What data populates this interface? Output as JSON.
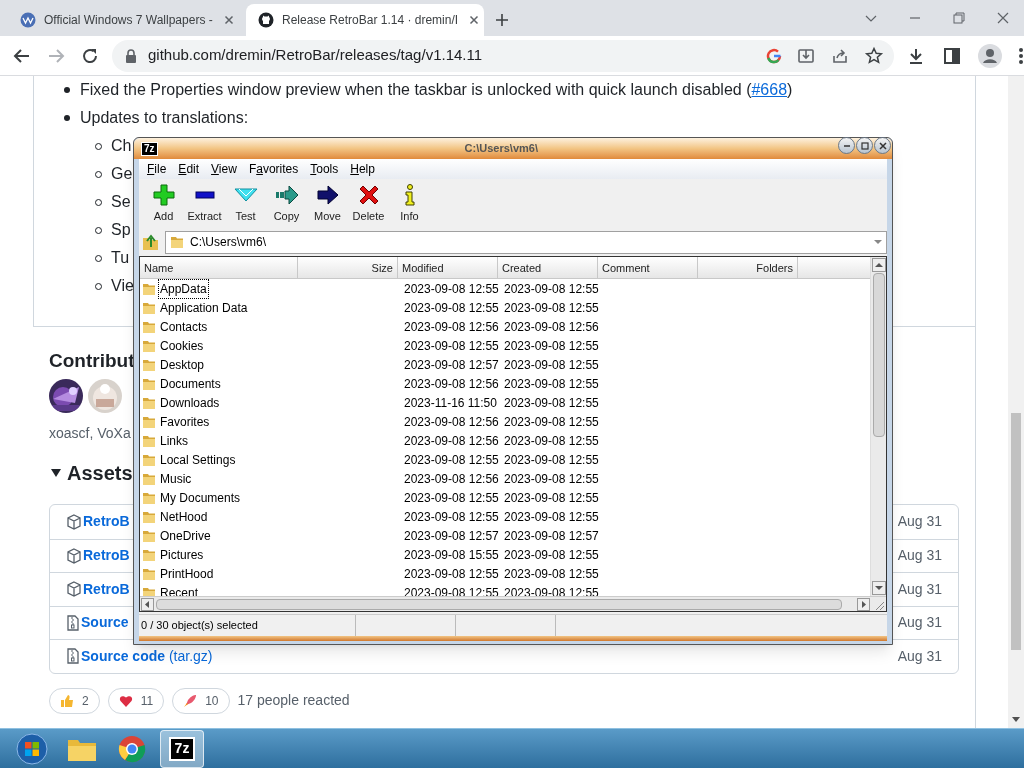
{
  "browser": {
    "tabs": [
      {
        "kind": "wallpapers",
        "title": "Official Windows 7 Wallpapers -",
        "selected": false
      },
      {
        "kind": "github",
        "title": "Release RetroBar 1.14 · dremin/I",
        "selected": true
      }
    ],
    "address": "github.com/dremin/RetroBar/releases/tag/v1.14.11"
  },
  "page": {
    "bullets": [
      {
        "text": "Fixed the Properties window preview when the taskbar is unlocked with quick launch disabled (",
        "link": "#668",
        "tail": ")"
      },
      {
        "text": "Updates to translations:",
        "subitems": [
          "Ch",
          "Ge",
          "Se",
          "Sp",
          "Tu",
          "Vie"
        ]
      }
    ],
    "contributors": {
      "heading": "Contribut",
      "names": "xoascf, VoXa"
    },
    "assets": {
      "heading": "Assets",
      "items": [
        {
          "kind": "package",
          "name": "RetroB",
          "date": "Aug 31"
        },
        {
          "kind": "package",
          "name": "RetroB",
          "date": "Aug 31"
        },
        {
          "kind": "package",
          "name": "RetroB",
          "date": "Aug 31"
        },
        {
          "kind": "source",
          "name": "Source",
          "date": "Aug 31"
        },
        {
          "kind": "source",
          "name": "Source code",
          "suffix": "(tar.gz)",
          "date": "Aug 31"
        }
      ]
    },
    "reactions": [
      {
        "kind": "thumbs-up",
        "count": "2"
      },
      {
        "kind": "heart",
        "count": "11"
      },
      {
        "kind": "rocket",
        "count": "10"
      }
    ],
    "reaction_summary": "17 people reacted"
  },
  "window": {
    "badge": "7z",
    "title": "C:\\Users\\vm6\\",
    "menu": [
      {
        "key": "F",
        "after": "ile"
      },
      {
        "key": "E",
        "after": "dit"
      },
      {
        "key": "V",
        "after": "iew"
      },
      {
        "before": "F",
        "key": "a",
        "after": "vorites"
      },
      {
        "key": "T",
        "after": "ools"
      },
      {
        "key": "H",
        "after": "elp"
      }
    ],
    "toolbar": [
      {
        "kind": "add",
        "label": "Add"
      },
      {
        "kind": "extract",
        "label": "Extract"
      },
      {
        "kind": "test",
        "label": "Test"
      },
      {
        "kind": "copy",
        "label": "Copy"
      },
      {
        "kind": "move",
        "label": "Move"
      },
      {
        "kind": "delete",
        "label": "Delete"
      },
      {
        "kind": "info",
        "label": "Info"
      }
    ],
    "path": "C:\\Users\\vm6\\",
    "columns": [
      {
        "label": "Name",
        "kind": "text"
      },
      {
        "label": "Size",
        "kind": "number"
      },
      {
        "label": "Modified",
        "kind": "text"
      },
      {
        "label": "Created",
        "kind": "text"
      },
      {
        "label": "Comment",
        "kind": "text"
      },
      {
        "label": "Folders",
        "kind": "number"
      }
    ],
    "rows": [
      {
        "name": "AppData",
        "modified": "2023-09-08 12:55",
        "created": "2023-09-08 12:55",
        "selected": true
      },
      {
        "name": "Application Data",
        "modified": "2023-09-08 12:55",
        "created": "2023-09-08 12:55",
        "selected": false
      },
      {
        "name": "Contacts",
        "modified": "2023-09-08 12:56",
        "created": "2023-09-08 12:56",
        "selected": false
      },
      {
        "name": "Cookies",
        "modified": "2023-09-08 12:55",
        "created": "2023-09-08 12:55",
        "selected": false
      },
      {
        "name": "Desktop",
        "modified": "2023-09-08 12:57",
        "created": "2023-09-08 12:55",
        "selected": false
      },
      {
        "name": "Documents",
        "modified": "2023-09-08 12:56",
        "created": "2023-09-08 12:55",
        "selected": false
      },
      {
        "name": "Downloads",
        "modified": "2023-11-16 11:50",
        "created": "2023-09-08 12:55",
        "selected": false
      },
      {
        "name": "Favorites",
        "modified": "2023-09-08 12:56",
        "created": "2023-09-08 12:55",
        "selected": false
      },
      {
        "name": "Links",
        "modified": "2023-09-08 12:56",
        "created": "2023-09-08 12:55",
        "selected": false
      },
      {
        "name": "Local Settings",
        "modified": "2023-09-08 12:55",
        "created": "2023-09-08 12:55",
        "selected": false
      },
      {
        "name": "Music",
        "modified": "2023-09-08 12:56",
        "created": "2023-09-08 12:55",
        "selected": false
      },
      {
        "name": "My Documents",
        "modified": "2023-09-08 12:55",
        "created": "2023-09-08 12:55",
        "selected": false
      },
      {
        "name": "NetHood",
        "modified": "2023-09-08 12:55",
        "created": "2023-09-08 12:55",
        "selected": false
      },
      {
        "name": "OneDrive",
        "modified": "2023-09-08 12:57",
        "created": "2023-09-08 12:57",
        "selected": false
      },
      {
        "name": "Pictures",
        "modified": "2023-09-08 15:55",
        "created": "2023-09-08 12:55",
        "selected": false
      },
      {
        "name": "PrintHood",
        "modified": "2023-09-08 12:55",
        "created": "2023-09-08 12:55",
        "selected": false
      },
      {
        "name": "Recent",
        "modified": "2023-09-08 12:55",
        "created": "2023-09-08 12:55",
        "selected": false
      }
    ],
    "status": "0 / 30 object(s) selected"
  },
  "taskbar": {
    "items": [
      {
        "kind": "start",
        "selected": false
      },
      {
        "kind": "explorer",
        "selected": false
      },
      {
        "kind": "chrome",
        "selected": false
      },
      {
        "kind": "sevenzip",
        "label": "7z",
        "selected": true
      }
    ]
  }
}
